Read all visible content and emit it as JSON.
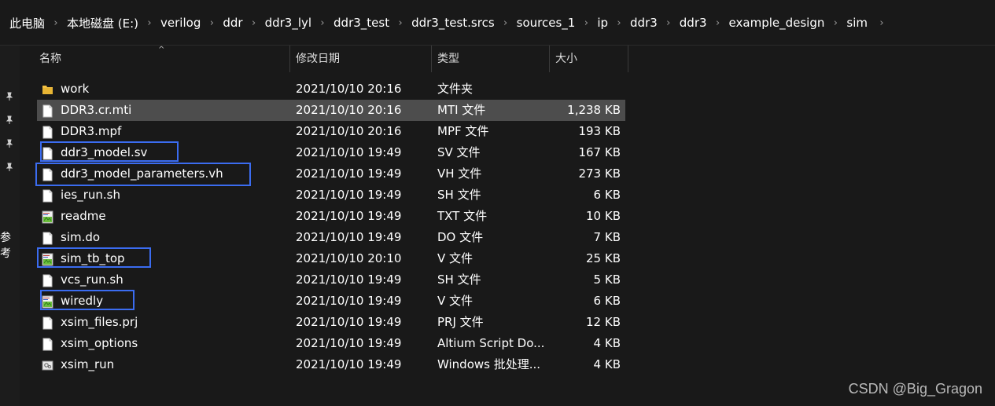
{
  "breadcrumb": {
    "items": [
      "此电脑",
      "本地磁盘 (E:)",
      "verilog",
      "ddr",
      "ddr3_lyl",
      "ddr3_test",
      "ddr3_test.srcs",
      "sources_1",
      "ip",
      "ddr3",
      "ddr3",
      "example_design",
      "sim"
    ],
    "separator": "›"
  },
  "sidebar": {
    "text": "参考"
  },
  "columns": {
    "name": "名称",
    "date": "修改日期",
    "type": "类型",
    "size": "大小"
  },
  "files": [
    {
      "name": "work",
      "date": "2021/10/10 20:16",
      "type": "文件夹",
      "size": "",
      "icon": "folder-icon"
    },
    {
      "name": "DDR3.cr.mti",
      "date": "2021/10/10 20:16",
      "type": "MTI 文件",
      "size": "1,238 KB",
      "icon": "file-icon"
    },
    {
      "name": "DDR3.mpf",
      "date": "2021/10/10 20:16",
      "type": "MPF 文件",
      "size": "193 KB",
      "icon": "file-icon"
    },
    {
      "name": "ddr3_model.sv",
      "date": "2021/10/10 19:49",
      "type": "SV 文件",
      "size": "167 KB",
      "icon": "file-icon"
    },
    {
      "name": "ddr3_model_parameters.vh",
      "date": "2021/10/10 19:49",
      "type": "VH 文件",
      "size": "273 KB",
      "icon": "file-icon"
    },
    {
      "name": "ies_run.sh",
      "date": "2021/10/10 19:49",
      "type": "SH 文件",
      "size": "6 KB",
      "icon": "file-icon"
    },
    {
      "name": "readme",
      "date": "2021/10/10 19:49",
      "type": "TXT 文件",
      "size": "10 KB",
      "icon": "text-editor-icon"
    },
    {
      "name": "sim.do",
      "date": "2021/10/10 19:49",
      "type": "DO 文件",
      "size": "7 KB",
      "icon": "file-icon"
    },
    {
      "name": "sim_tb_top",
      "date": "2021/10/10 20:10",
      "type": "V 文件",
      "size": "25 KB",
      "icon": "text-editor-icon"
    },
    {
      "name": "vcs_run.sh",
      "date": "2021/10/10 19:49",
      "type": "SH 文件",
      "size": "5 KB",
      "icon": "file-icon"
    },
    {
      "name": "wiredly",
      "date": "2021/10/10 19:49",
      "type": "V 文件",
      "size": "6 KB",
      "icon": "text-editor-icon"
    },
    {
      "name": "xsim_files.prj",
      "date": "2021/10/10 19:49",
      "type": "PRJ 文件",
      "size": "12 KB",
      "icon": "file-icon"
    },
    {
      "name": "xsim_options",
      "date": "2021/10/10 19:49",
      "type": "Altium Script Do...",
      "size": "4 KB",
      "icon": "file-icon"
    },
    {
      "name": "xsim_run",
      "date": "2021/10/10 19:49",
      "type": "Windows 批处理...",
      "size": "4 KB",
      "icon": "batch-file-icon"
    }
  ],
  "selected_file": "DDR3.cr.mti",
  "highlighted_files": [
    "ddr3_model.sv",
    "ddr3_model_parameters.vh",
    "sim_tb_top",
    "wiredly"
  ],
  "watermark": "CSDN @Big_Gragon",
  "colors": {
    "background": "#191919",
    "selection": "#4d4d4d",
    "highlight_box": "#3b6cf0",
    "folder": "#f5c142"
  }
}
